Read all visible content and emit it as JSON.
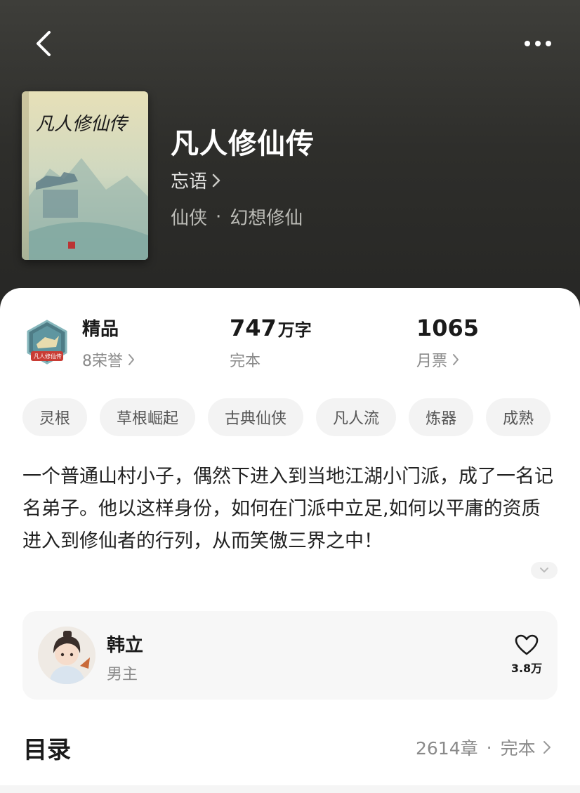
{
  "colors": {
    "header_bg": "#2e2e2b",
    "card_bg": "#ffffff",
    "tag_bg": "#f3f3f3",
    "muted_text": "#8a8a8a"
  },
  "nav": {
    "back_icon": "chevron-left-icon",
    "more_icon": "ellipsis-icon"
  },
  "book": {
    "title": "凡人修仙传",
    "cover_title": "凡人修仙传",
    "author": "忘语",
    "genre_main": "仙侠",
    "genre_sep": "·",
    "genre_sub": "幻想修仙"
  },
  "stats": {
    "honor": {
      "label": "精品",
      "sub": "8荣誉",
      "badge_text": "凡人修仙传"
    },
    "words": {
      "num": "747",
      "unit": "万字",
      "sub": "完本"
    },
    "tickets": {
      "num": "1065",
      "sub": "月票"
    }
  },
  "tags": [
    "灵根",
    "草根崛起",
    "古典仙侠",
    "凡人流",
    "炼器",
    "成熟"
  ],
  "description": "一个普通山村小子，偶然下进入到当地江湖小门派，成了一名记名弟子。他以这样身份，如何在门派中立足,如何以平庸的资质进入到修仙者的行列，从而笑傲三界之中！",
  "character": {
    "name": "韩立",
    "role": "男主",
    "likes": "3.8万"
  },
  "toc": {
    "title": "目录",
    "chapters": "2614章",
    "sep": "·",
    "status": "完本"
  }
}
